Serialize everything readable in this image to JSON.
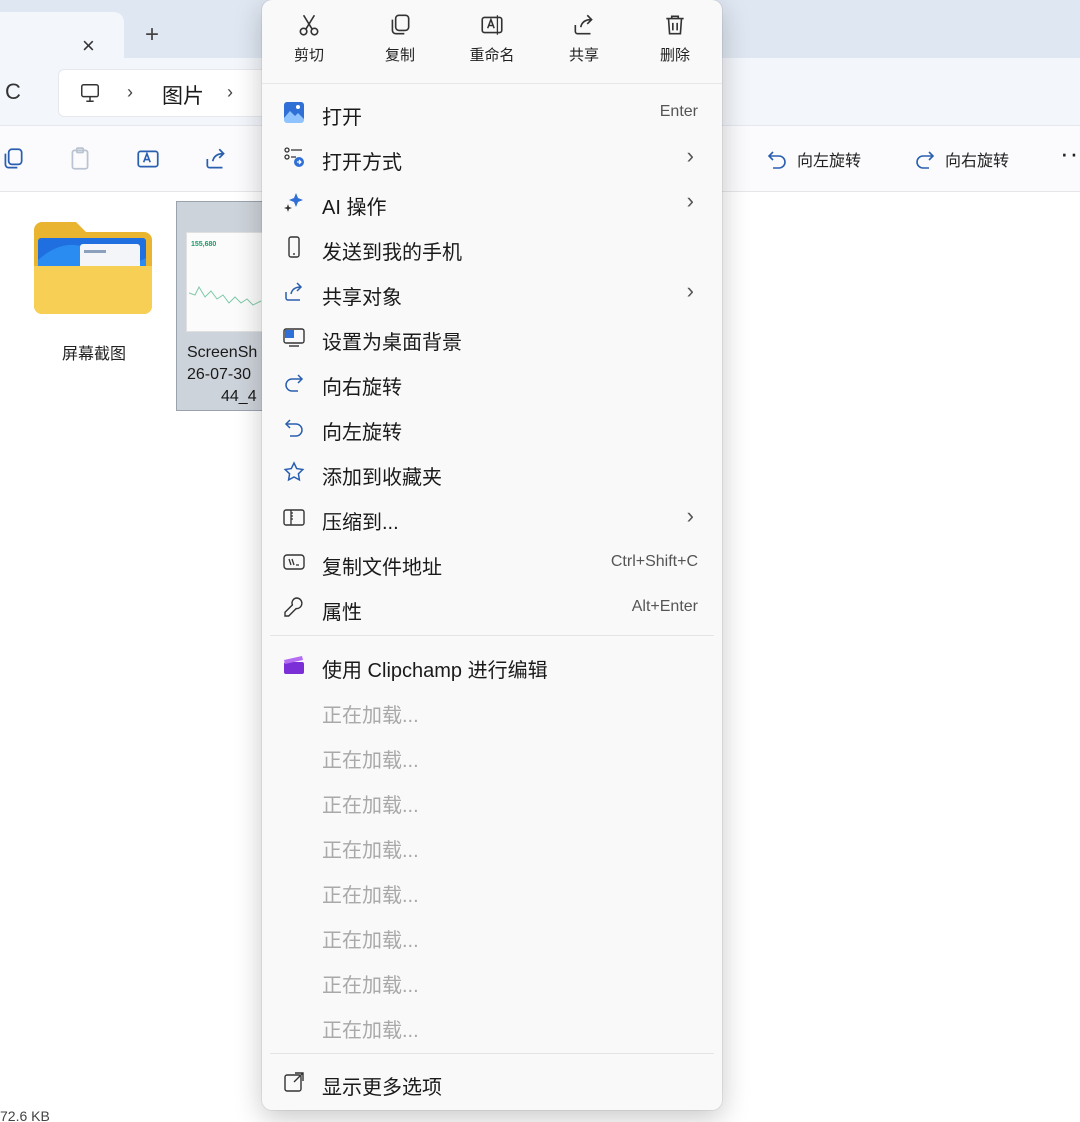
{
  "tab": {
    "close": "×",
    "add": "+"
  },
  "address": {
    "refresh": "C",
    "sep1": "›",
    "crumb": "图片",
    "sep2": "›"
  },
  "command_bar": {
    "rotate_left": "向左旋转",
    "rotate_right": "向右旋转",
    "more": "···"
  },
  "files": {
    "folder_name": "屏幕截图",
    "image_name_lines": [
      "ScreenSh",
      "26-07-30",
      "44_4"
    ],
    "thumb_value": "155,680"
  },
  "status": {
    "size": "72.6 KB"
  },
  "menu": {
    "quick_actions": [
      {
        "label": "剪切",
        "icon": "cut-icon"
      },
      {
        "label": "复制",
        "icon": "copy-icon"
      },
      {
        "label": "重命名",
        "icon": "rename-icon"
      },
      {
        "label": "共享",
        "icon": "share-icon"
      },
      {
        "label": "删除",
        "icon": "trash-icon"
      }
    ],
    "items": [
      {
        "label": "打开",
        "shortcut": "Enter",
        "icon": "photos-icon"
      },
      {
        "label": "打开方式",
        "submenu": "›",
        "icon": "open-with-icon"
      },
      {
        "label": "AI 操作",
        "submenu": "›",
        "icon": "ai-sparkle-icon"
      },
      {
        "label": "发送到我的手机",
        "icon": "phone-icon"
      },
      {
        "label": "共享对象",
        "submenu": "›",
        "icon": "share-icon"
      },
      {
        "label": "设置为桌面背景",
        "icon": "desktop-background-icon"
      },
      {
        "label": "向右旋转",
        "icon": "rotate-right-icon"
      },
      {
        "label": "向左旋转",
        "icon": "rotate-left-icon"
      },
      {
        "label": "添加到收藏夹",
        "icon": "star-icon"
      },
      {
        "label": "压缩到...",
        "submenu": "›",
        "icon": "zip-icon"
      },
      {
        "label": "复制文件地址",
        "shortcut": "Ctrl+Shift+C",
        "icon": "copy-path-icon"
      },
      {
        "label": "属性",
        "shortcut": "Alt+Enter",
        "icon": "wrench-icon"
      }
    ],
    "clipchamp": {
      "label": "使用 Clipchamp 进行编辑",
      "icon": "clipchamp-icon"
    },
    "loading": [
      "正在加载...",
      "正在加载...",
      "正在加载...",
      "正在加载...",
      "正在加载...",
      "正在加载...",
      "正在加载...",
      "正在加载..."
    ],
    "more_options": {
      "label": "显示更多选项",
      "icon": "more-options-icon"
    }
  },
  "colors": {
    "accent": "#2f6fd6",
    "clipchamp": "#7b2fd6",
    "folder": "#f5c84b"
  }
}
